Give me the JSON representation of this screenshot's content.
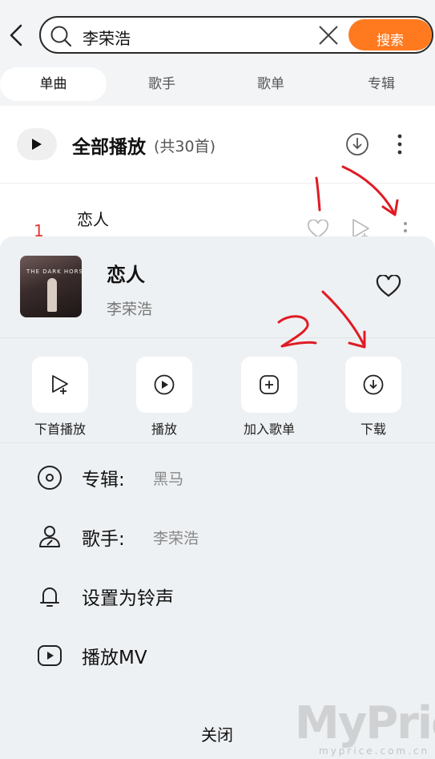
{
  "search": {
    "value": "李荣浩",
    "button_label": "搜索"
  },
  "tabs": [
    {
      "label": "单曲",
      "active": true
    },
    {
      "label": "歌手",
      "active": false
    },
    {
      "label": "歌单",
      "active": false
    },
    {
      "label": "专辑",
      "active": false
    }
  ],
  "play_all": {
    "title": "全部播放",
    "count": "(共30首)"
  },
  "song_row": {
    "number": "1",
    "title": "恋人"
  },
  "sheet": {
    "title": "恋人",
    "artist": "李荣浩",
    "cover_text": "THE DARK HORSE",
    "actions": [
      {
        "label": "下首播放",
        "icon": "play-next-icon"
      },
      {
        "label": "播放",
        "icon": "play-circle-icon"
      },
      {
        "label": "加入歌单",
        "icon": "add-to-playlist-icon"
      },
      {
        "label": "下载",
        "icon": "download-icon"
      }
    ],
    "info": [
      {
        "label": "专辑:",
        "value": "黑马",
        "icon": "album-disc-icon"
      },
      {
        "label": "歌手:",
        "value": "李荣浩",
        "icon": "singer-icon"
      },
      {
        "label": "设置为铃声",
        "value": "",
        "icon": "bell-icon"
      },
      {
        "label": "播放MV",
        "value": "",
        "icon": "mv-play-icon"
      }
    ],
    "close_label": "关闭"
  },
  "annotations": {
    "step1": "1",
    "step2": "2",
    "color": "#e01b24"
  },
  "watermark": {
    "main": "MyPrice",
    "sub": "myprice.com.cn"
  },
  "colors": {
    "accent": "#ff7a1f",
    "sheet_bg": "#eef1f3",
    "tab_bg": "#f2f4f6"
  }
}
